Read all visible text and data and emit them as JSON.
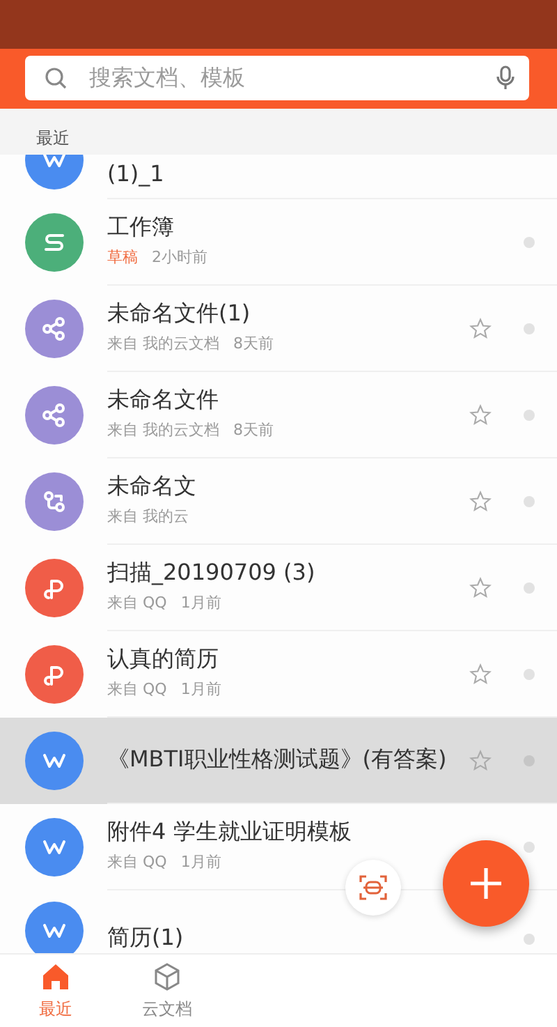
{
  "search": {
    "placeholder": "搜索文档、模板"
  },
  "section": "最近",
  "files": [
    {
      "kind": "word",
      "name": "(1)_1",
      "selected": false,
      "partial": true
    },
    {
      "kind": "sheet",
      "name": "工作簿",
      "source": "草稿",
      "draft": true,
      "time": "2小时前",
      "star": false,
      "selected": false
    },
    {
      "kind": "share",
      "name": "未命名文件(1)",
      "source": "来自 我的云文档",
      "time": "8天前",
      "star": true,
      "selected": false
    },
    {
      "kind": "share",
      "name": "未命名文件",
      "source": "来自 我的云文档",
      "time": "8天前",
      "star": true,
      "selected": false
    },
    {
      "kind": "flow",
      "name": "未命名文",
      "source": "来自 我的云",
      "star": true,
      "selected": false
    },
    {
      "kind": "pdf",
      "name": "扫描_20190709 (3)",
      "source": "来自 QQ",
      "time": "1月前",
      "star": true,
      "selected": false
    },
    {
      "kind": "pdf",
      "name": "认真的简历",
      "source": "来自 QQ",
      "time": "1月前",
      "star": true,
      "selected": false
    },
    {
      "kind": "word",
      "name": "《MBTI职业性格测试题》(有答案)",
      "star": true,
      "selected": true
    },
    {
      "kind": "word",
      "name": "附件4 学生就业证明模板",
      "source": "来自 QQ",
      "time": "1月前",
      "star": false,
      "selected": false
    },
    {
      "kind": "word",
      "name": "简历(1)",
      "star": false,
      "selected": false
    }
  ],
  "tabs": [
    {
      "label": "最近",
      "selected": true
    },
    {
      "label": "云文档",
      "selected": false
    }
  ]
}
